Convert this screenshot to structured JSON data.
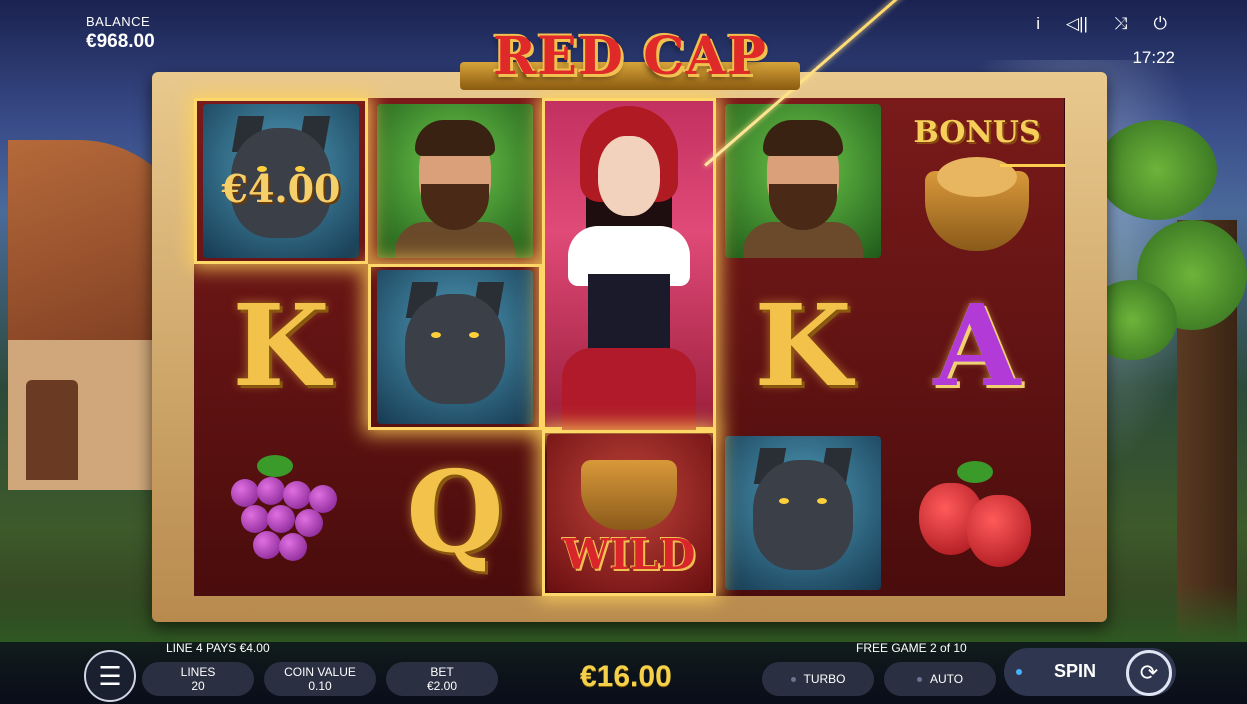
{
  "game": {
    "title": "RED CAP"
  },
  "balance": {
    "label": "BALANCE",
    "value": "€968.00"
  },
  "top_icons": [
    "info-icon",
    "sound-icon",
    "fullscreen-icon",
    "power-icon"
  ],
  "top_icon_glyphs": {
    "info": "i",
    "sound": "◁||",
    "fullscreen": "⤨",
    "power": "⏻"
  },
  "clock": "17:22",
  "reels": [
    {
      "symbols": [
        "wolf",
        "K",
        "grapes"
      ],
      "highlight": [
        0
      ]
    },
    {
      "symbols": [
        "woodsman",
        "wolf",
        "Q"
      ],
      "highlight": [
        1
      ]
    },
    {
      "symbols": [
        "red-cap-girl (stacked)",
        "wild"
      ],
      "highlight": [
        0,
        1
      ]
    },
    {
      "symbols": [
        "woodsman",
        "K",
        "wolf"
      ],
      "highlight": []
    },
    {
      "symbols": [
        "bonus",
        "A",
        "strawberries"
      ],
      "highlight": []
    }
  ],
  "symbol_text": {
    "win_on_reel1": "€4.00",
    "k": "K",
    "q": "Q",
    "a": "A",
    "wild": "WILD",
    "bonus": "BONUS"
  },
  "status": {
    "line_win": "LINE 4 PAYS €4.00",
    "free_games": "FREE GAME 2 of 10"
  },
  "controls": {
    "menu_glyph": "☰",
    "lines": {
      "label": "LINES",
      "value": "20"
    },
    "coin_value": {
      "label": "COIN VALUE",
      "value": "0.10"
    },
    "bet": {
      "label": "BET",
      "value": "€2.00"
    },
    "total_win": "€16.00",
    "turbo": "TURBO",
    "auto": "AUTO",
    "spin": "SPIN",
    "spin_glyph": "⟳"
  },
  "colors": {
    "gold": "#f2c24a",
    "accent_red": "#e02a2a",
    "highlight": "#ffd86a"
  }
}
